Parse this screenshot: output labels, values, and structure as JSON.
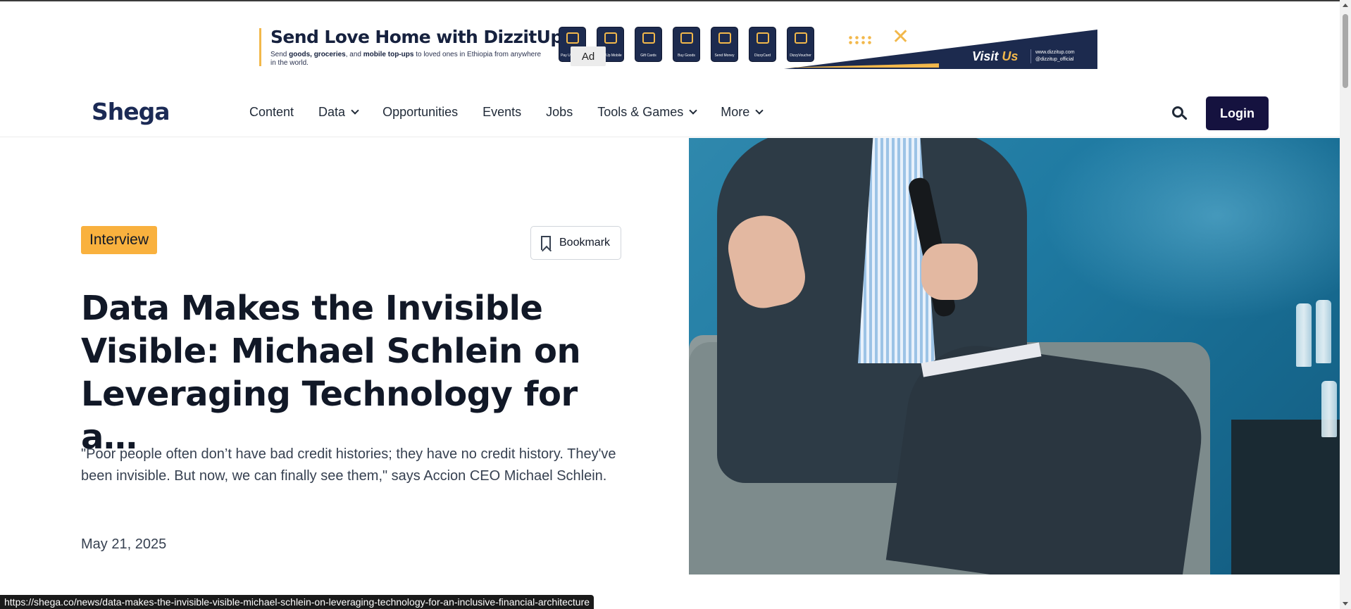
{
  "ad": {
    "badge": "Ad",
    "title": "Send Love Home with DizzitUp!",
    "subtitle_parts": [
      "Send ",
      "goods, groceries",
      ", and ",
      "mobile top-ups",
      " to loved ones in Ethiopia from anywhere in the world."
    ],
    "services": [
      {
        "label": "Pay Utility Bills",
        "icon": "bill-icon"
      },
      {
        "label": "Top-Up Mobile",
        "icon": "phone-icon"
      },
      {
        "label": "Gift Cards",
        "icon": "gift-card-icon"
      },
      {
        "label": "Buy Goods",
        "icon": "cart-icon"
      },
      {
        "label": "Send Money",
        "icon": "money-icon"
      },
      {
        "label": "DizzyCard",
        "icon": "card-icon"
      },
      {
        "label": "DizzyVoucher",
        "icon": "voucher-icon"
      }
    ],
    "visit_prefix": "Visit ",
    "visit_suffix": "Us",
    "website": "www.dizzitup.com",
    "social": "@dizzitup_official"
  },
  "header": {
    "logo": "Shega",
    "nav": [
      {
        "label": "Content",
        "dropdown": false
      },
      {
        "label": "Data",
        "dropdown": true
      },
      {
        "label": "Opportunities",
        "dropdown": false
      },
      {
        "label": "Events",
        "dropdown": false
      },
      {
        "label": "Jobs",
        "dropdown": false
      },
      {
        "label": "Tools & Games",
        "dropdown": true
      },
      {
        "label": "More",
        "dropdown": true
      }
    ],
    "search_icon": "search-icon",
    "login_label": "Login"
  },
  "article": {
    "tag": "Interview",
    "bookmark_label": "Bookmark",
    "title": "Data Makes the Invisible Visible: Michael Schlein on Leveraging Technology for a…",
    "lede": "\"Poor people often don’t have bad credit histories; they have no credit history. They've been invisible. But now, we can finally see them,\" says Accion CEO Michael Schlein.",
    "date": "May 21, 2025"
  },
  "status_url": "https://shega.co/news/data-makes-the-invisible-visible-michael-schlein-on-leveraging-technology-for-an-inclusive-financial-architecture",
  "colors": {
    "brand_navy": "#15123f",
    "tag_orange": "#f9b13e",
    "ad_navy": "#1c2a4e",
    "ad_yellow": "#f2b84b"
  }
}
